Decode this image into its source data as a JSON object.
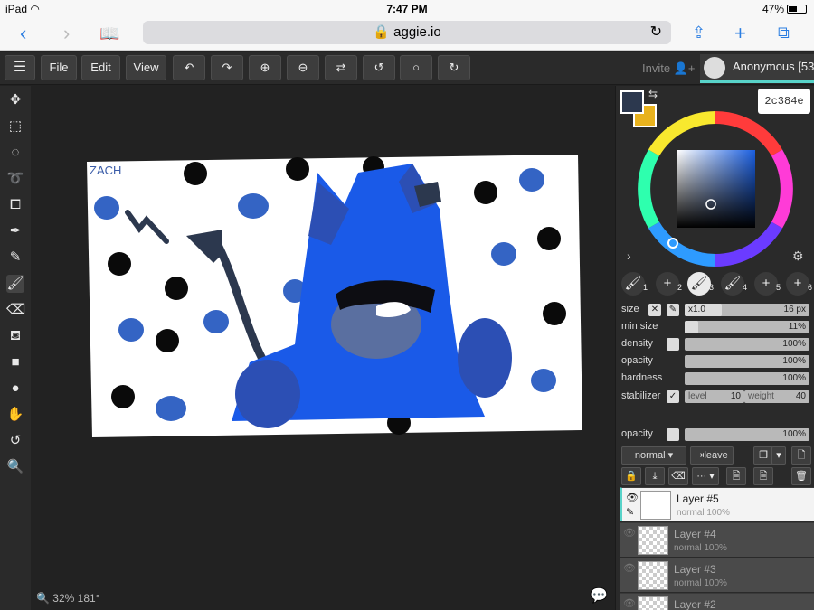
{
  "status_bar": {
    "device": "iPad",
    "time": "7:47 PM",
    "battery": "47%"
  },
  "browser": {
    "url": "aggie.io"
  },
  "toolbar": {
    "menu_icon": "hamburger-icon",
    "file_label": "File",
    "edit_label": "Edit",
    "view_label": "View",
    "invite_label": "Invite",
    "user_label": "Anonymous [53."
  },
  "tools": [
    "move-icon",
    "rect-select-icon",
    "ellipse-select-icon",
    "lasso-icon",
    "transform-icon",
    "eyedropper-icon",
    "pencil-icon",
    "brush-icon",
    "eraser-icon",
    "fill-icon",
    "rectangle-icon",
    "ellipse-icon",
    "hand-icon",
    "rotate-icon",
    "zoom-icon"
  ],
  "canvas": {
    "signature": "ZACH",
    "zoom_label": "32% 181°"
  },
  "color": {
    "primary": "#2c384e",
    "secondary": "#e8b21e",
    "hex": "2c384e"
  },
  "brush_slots": [
    "1",
    "2",
    "3",
    "4",
    "5",
    "6"
  ],
  "brush_settings": {
    "size_label": "size",
    "size_multiplier": "x1.0",
    "size_value": "16 px",
    "min_size_label": "min size",
    "min_size_value": "11%",
    "density_label": "density",
    "density_value": "100%",
    "opacity_label": "opacity",
    "opacity_value": "100%",
    "hardness_label": "hardness",
    "hardness_value": "100%",
    "stabilizer_label": "stabilizer",
    "level_label": "level",
    "level_value": "10",
    "weight_label": "weight",
    "weight_value": "40"
  },
  "layer_panel": {
    "opacity_label": "opacity",
    "opacity_value": "100%",
    "blend_mode": "normal",
    "leave_label": "leave"
  },
  "layers": [
    {
      "name": "Layer #5",
      "meta": "normal 100%"
    },
    {
      "name": "Layer #4",
      "meta": "normal 100%"
    },
    {
      "name": "Layer #3",
      "meta": "normal 100%"
    },
    {
      "name": "Layer #2",
      "meta": ""
    }
  ]
}
